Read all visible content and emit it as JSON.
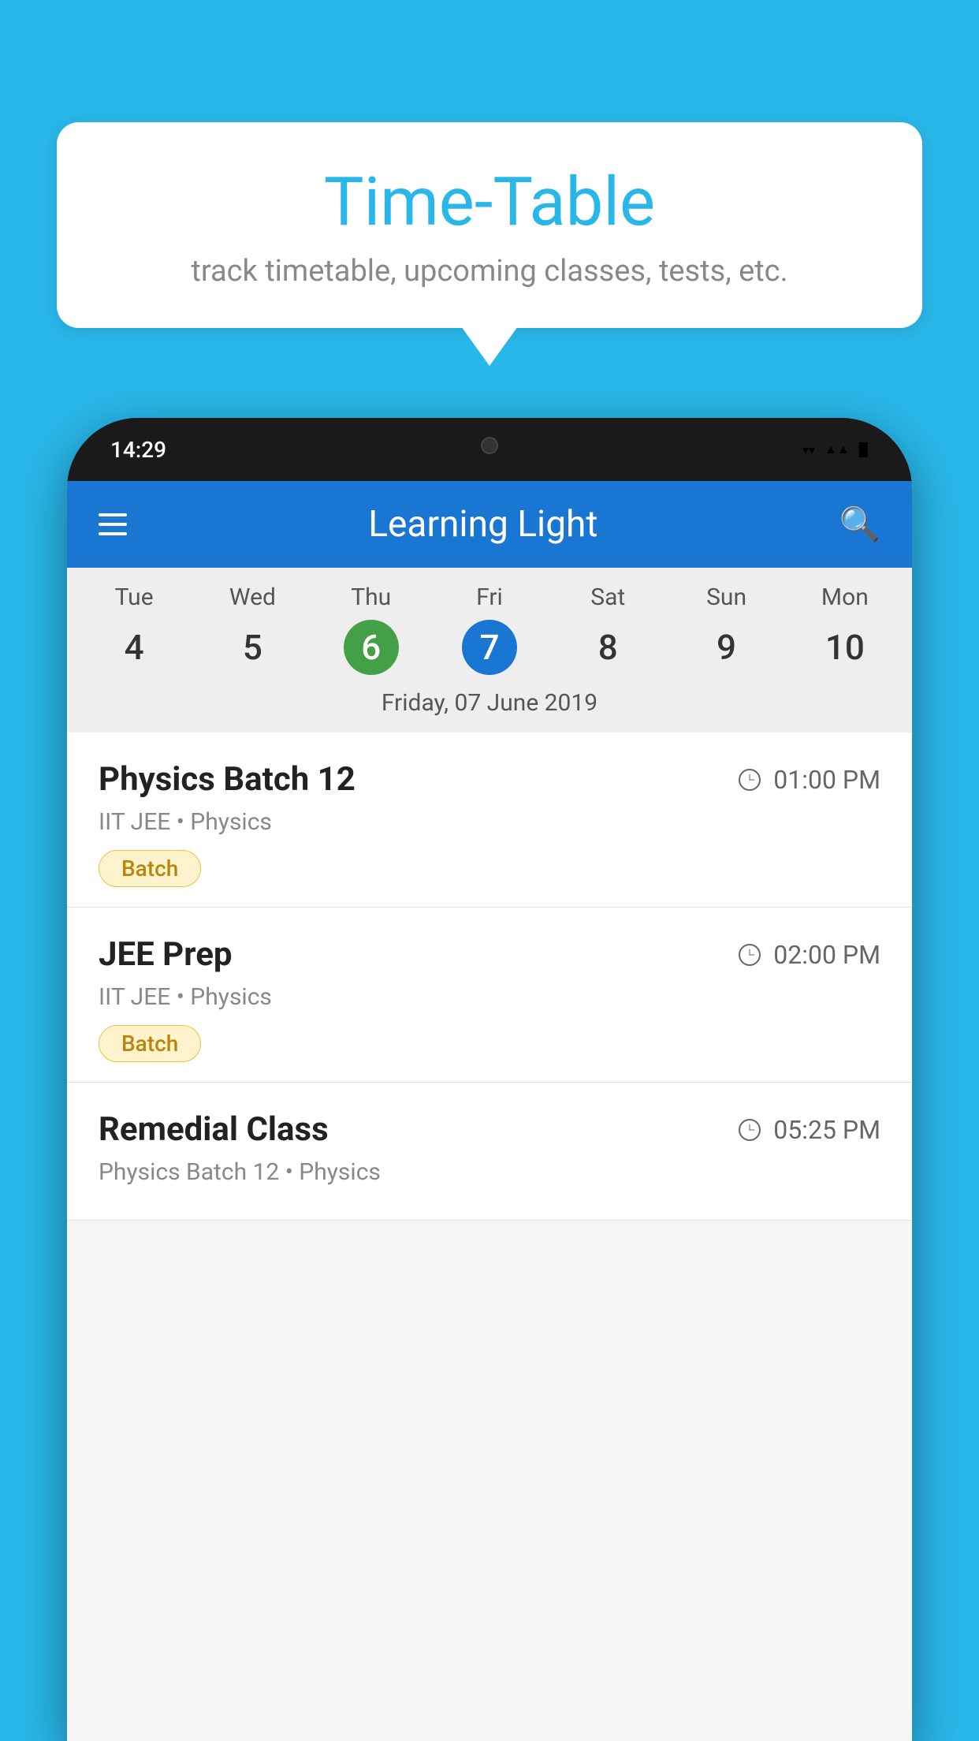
{
  "background_color": "#29b6e8",
  "speech_bubble": {
    "title": "Time-Table",
    "subtitle": "track timetable, upcoming classes, tests, etc."
  },
  "phone": {
    "status_bar": {
      "time": "14:29"
    },
    "app_header": {
      "title": "Learning Light"
    },
    "calendar": {
      "days": [
        {
          "label": "Tue",
          "number": "4",
          "state": "normal"
        },
        {
          "label": "Wed",
          "number": "5",
          "state": "normal"
        },
        {
          "label": "Thu",
          "number": "6",
          "state": "today"
        },
        {
          "label": "Fri",
          "number": "7",
          "state": "selected"
        },
        {
          "label": "Sat",
          "number": "8",
          "state": "normal"
        },
        {
          "label": "Sun",
          "number": "9",
          "state": "normal"
        },
        {
          "label": "Mon",
          "number": "10",
          "state": "normal"
        }
      ],
      "selected_date_label": "Friday, 07 June 2019"
    },
    "classes": [
      {
        "name": "Physics Batch 12",
        "time": "01:00 PM",
        "meta": "IIT JEE • Physics",
        "tag": "Batch"
      },
      {
        "name": "JEE Prep",
        "time": "02:00 PM",
        "meta": "IIT JEE • Physics",
        "tag": "Batch"
      },
      {
        "name": "Remedial Class",
        "time": "05:25 PM",
        "meta": "Physics Batch 12 • Physics",
        "tag": ""
      }
    ]
  }
}
